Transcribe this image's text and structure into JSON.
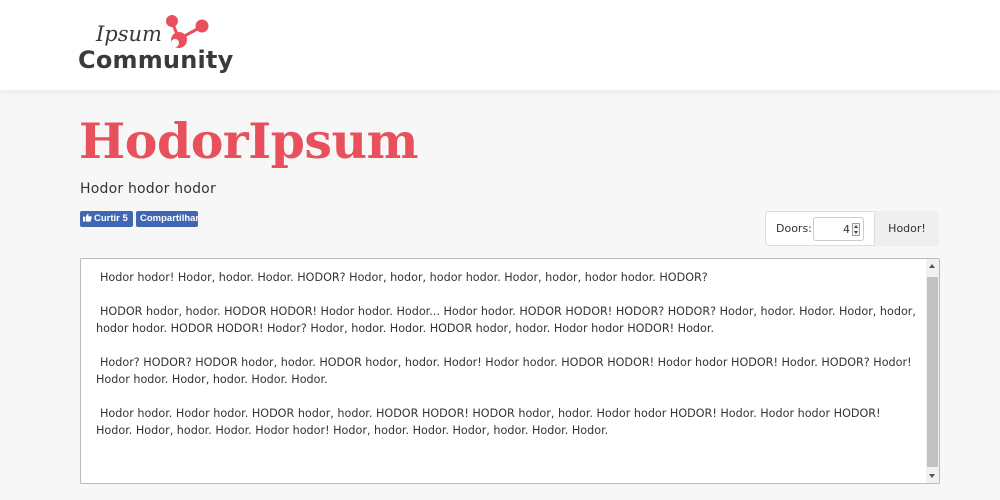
{
  "logo": {
    "top_word": "Ipsum",
    "bottom_word": "Community",
    "accent_color": "#e8505b"
  },
  "page": {
    "title": "HodorIpsum",
    "subtitle": "Hodor hodor hodor"
  },
  "social": {
    "like_label": "Curtir 5",
    "share_label": "Compartilhar",
    "color": "#4267b2"
  },
  "generator": {
    "doors_label": "Doors:",
    "doors_value": "4",
    "button_label": "Hodor!"
  },
  "output": {
    "paragraphs": [
      "Hodor hodor! Hodor, hodor. Hodor. HODOR? Hodor, hodor, hodor hodor. Hodor, hodor, hodor hodor. HODOR?",
      "HODOR hodor, hodor. HODOR HODOR! Hodor hodor. Hodor... Hodor hodor. HODOR HODOR! HODOR? HODOR? Hodor, hodor. Hodor. Hodor, hodor, hodor hodor. HODOR HODOR! Hodor? Hodor, hodor. Hodor. HODOR hodor, hodor. Hodor hodor HODOR! Hodor.",
      "Hodor? HODOR? HODOR hodor, hodor. HODOR hodor, hodor. Hodor! Hodor hodor. HODOR HODOR! Hodor hodor HODOR! Hodor. HODOR? Hodor! Hodor hodor. Hodor, hodor. Hodor. Hodor.",
      "Hodor hodor. Hodor hodor. HODOR hodor, hodor. HODOR HODOR! HODOR hodor, hodor. Hodor hodor HODOR! Hodor. Hodor hodor HODOR! Hodor. Hodor, hodor. Hodor. Hodor hodor! Hodor, hodor. Hodor. Hodor, hodor. Hodor. Hodor."
    ]
  }
}
